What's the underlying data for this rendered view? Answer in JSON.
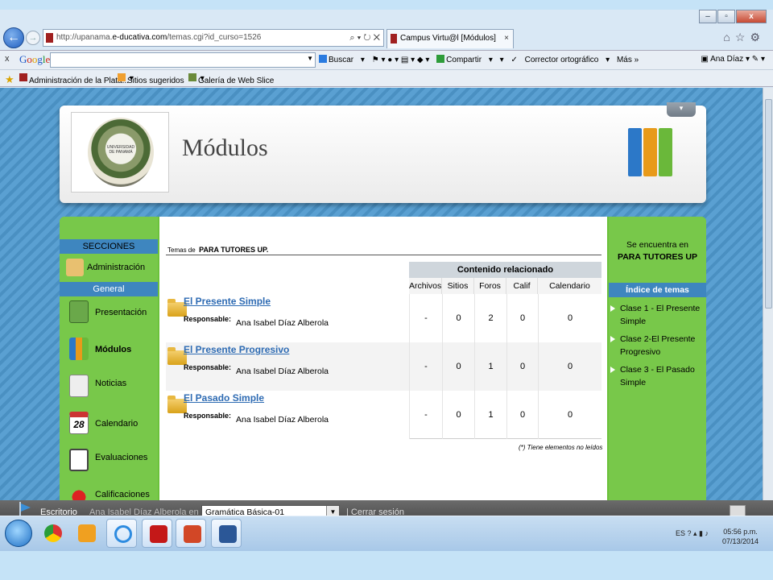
{
  "browser": {
    "url_prefix": "http://upanama.",
    "url_domain": "e-ducativa.com",
    "url_suffix": "/temas.cgi?id_curso=1526",
    "tab_title": "Campus Virtu@l [Módulos]",
    "tab_close": "×",
    "win_min": "–",
    "win_max": "▫",
    "win_close": "x"
  },
  "google_toolbar": {
    "close": "x",
    "buscar": "Buscar",
    "compartir": "Compartir",
    "corrector": "Corrector ortográfico",
    "mas": "Más »",
    "user": "Ana Díaz"
  },
  "favorites": {
    "item1": "Administración de la Plata...",
    "item2": "Sitios sugeridos",
    "item3": "Galería de Web Slice"
  },
  "header": {
    "title": "Módulos",
    "seal_text": "UNIVERSIDAD DE PANAMÁ"
  },
  "nav": {
    "secciones": "SECCIONES",
    "administracion": "Administración",
    "general": "General",
    "items": [
      {
        "label": "Presentación"
      },
      {
        "label": "Módulos"
      },
      {
        "label": "Noticias"
      },
      {
        "label": "Calendario"
      },
      {
        "label": "Evaluaciones"
      },
      {
        "label": "Calificaciones"
      }
    ],
    "calendar_day": "28"
  },
  "main": {
    "temas_de": "Temas de",
    "course": "PARA TUTORES UP.",
    "contenido": "Contenido relacionado",
    "columns": [
      "Archivos",
      "Sitios",
      "Foros",
      "Calif",
      "Calendario"
    ],
    "responsable_label": "Responsable:",
    "rows": [
      {
        "name": "El Presente Simple",
        "responsable": "Ana Isabel Díaz Alberola",
        "archivos": "-",
        "sitios": "0",
        "foros": "2",
        "calif": "0",
        "calendario": "0"
      },
      {
        "name": "El Presente Progresivo",
        "responsable": "Ana Isabel Díaz Alberola",
        "archivos": "-",
        "sitios": "0",
        "foros": "1",
        "calif": "0",
        "calendario": "0"
      },
      {
        "name": "El Pasado Simple",
        "responsable": "Ana Isabel Díaz Alberola",
        "archivos": "-",
        "sitios": "0",
        "foros": "1",
        "calif": "0",
        "calendario": "0"
      }
    ],
    "note": "(*) Tiene elementos no leídos"
  },
  "right": {
    "encuentra": "Se encuentra en",
    "location": "PARA TUTORES UP",
    "indice": "Índice de temas",
    "clases": [
      {
        "label": "Clase 1 - El Presente Simple"
      },
      {
        "label": "Clase 2-El Presente Progresivo"
      },
      {
        "label": "Clase 3 - El Pasado Simple"
      }
    ]
  },
  "bottom": {
    "escritorio": "Escritorio",
    "user_in": "Ana Isabel Díaz Alberola en",
    "course_select": "Gramática Básica-01",
    "cerrar": "| Cerrar sesión"
  },
  "taskbar": {
    "lang": "ES",
    "time": "05:56 p.m.",
    "date": "07/13/2014"
  },
  "colors": {
    "green": "#6bc13a",
    "nav_blue": "#3e86bf",
    "link_blue": "#2e6bb3"
  }
}
